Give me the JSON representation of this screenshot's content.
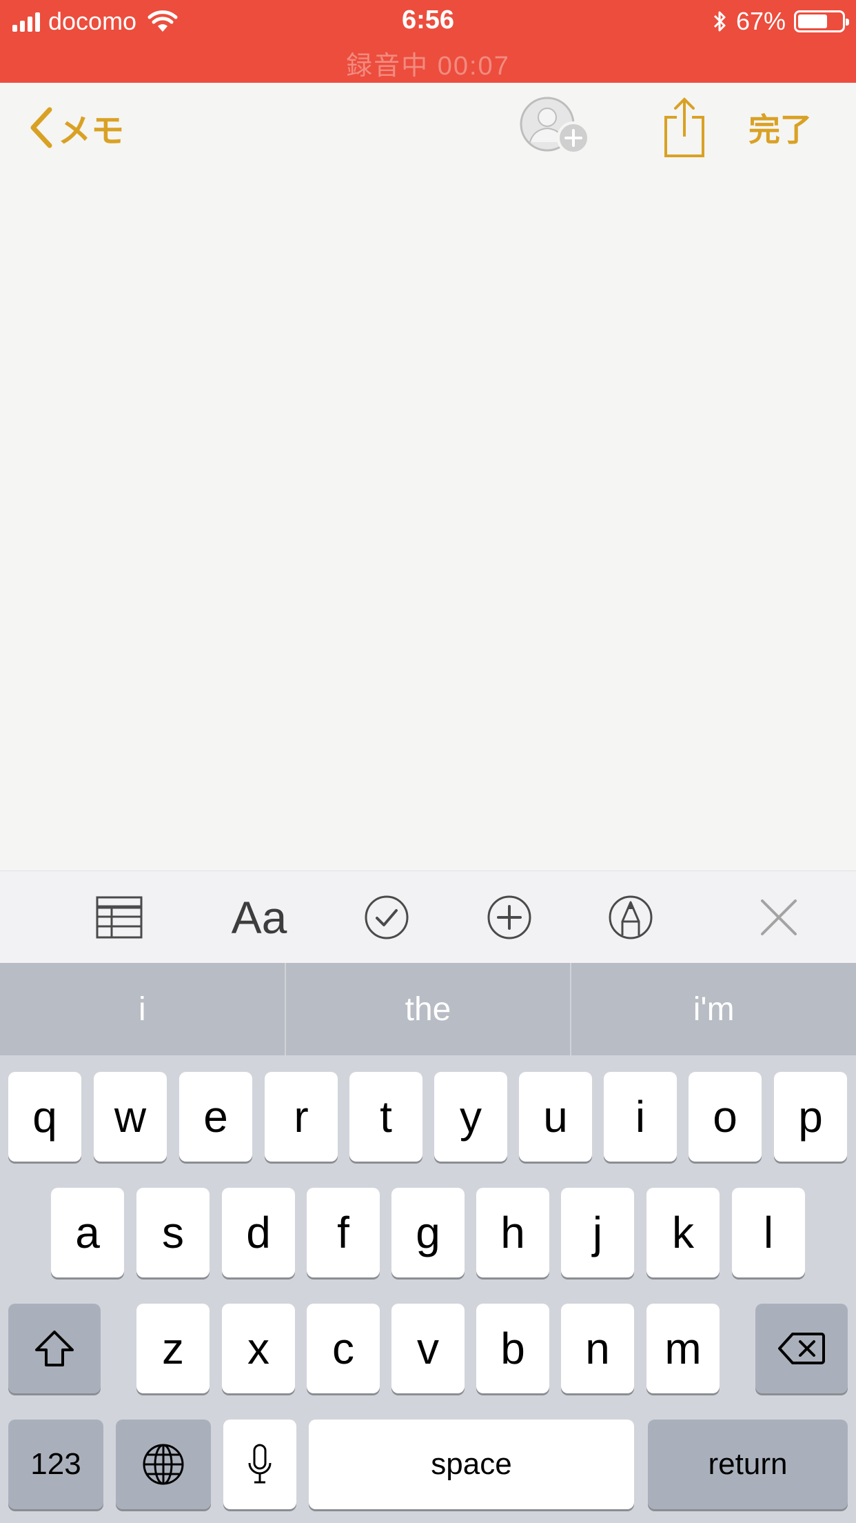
{
  "status_bar": {
    "carrier": "docomo",
    "time": "6:56",
    "battery_percent": "67%",
    "battery_level": 0.67,
    "recording_text": "録音中  00:07",
    "signal_bars": 4
  },
  "nav": {
    "back_label": "メモ",
    "done_label": "完了"
  },
  "format_bar": {
    "text_style_label": "Aa"
  },
  "predictions": [
    "i",
    "the",
    "i'm"
  ],
  "keyboard": {
    "row1": [
      "q",
      "w",
      "e",
      "r",
      "t",
      "y",
      "u",
      "i",
      "o",
      "p"
    ],
    "row2": [
      "a",
      "s",
      "d",
      "f",
      "g",
      "h",
      "j",
      "k",
      "l"
    ],
    "row3": [
      "z",
      "x",
      "c",
      "v",
      "b",
      "n",
      "m"
    ],
    "numbers_label": "123",
    "space_label": "space",
    "return_label": "return"
  },
  "colors": {
    "status_bar": "#ec4d3d",
    "accent": "#d9a124",
    "note_background": "#f5f5f3"
  }
}
